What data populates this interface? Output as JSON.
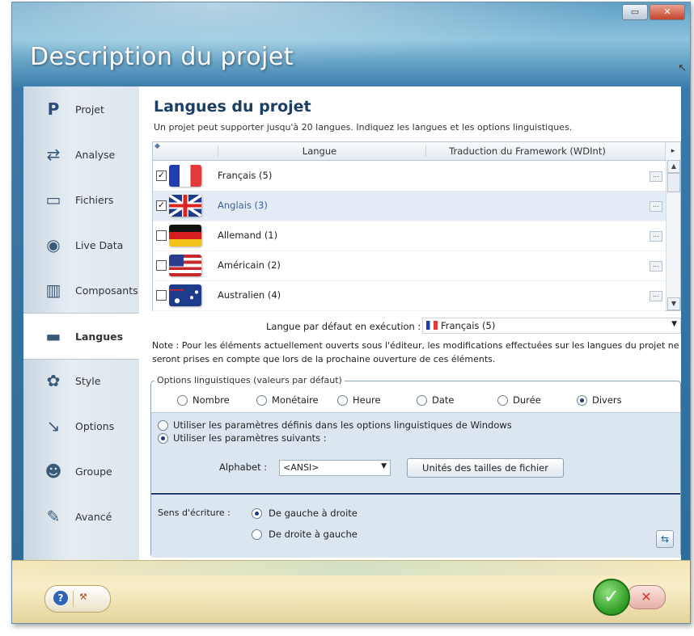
{
  "window": {
    "title": "Description du projet",
    "minimize": "▭",
    "close": "✕"
  },
  "sidebar": {
    "items": [
      {
        "label": "Projet",
        "icon": "P"
      },
      {
        "label": "Analyse",
        "icon": "⇄"
      },
      {
        "label": "Fichiers",
        "icon": "▭"
      },
      {
        "label": "Live Data",
        "icon": "◉"
      },
      {
        "label": "Composants",
        "icon": "▥"
      },
      {
        "label": "Langues",
        "icon": "▬"
      },
      {
        "label": "Style",
        "icon": "✿"
      },
      {
        "label": "Options",
        "icon": "↘"
      },
      {
        "label": "Groupe",
        "icon": "☻"
      },
      {
        "label": "Avancé",
        "icon": "✎"
      }
    ]
  },
  "main": {
    "heading": "Langues du projet",
    "intro": "Un projet peut supporter jusqu'à 20 langues. Indiquez les langues et les options linguistiques.",
    "table": {
      "columns": [
        "Langue",
        "Traduction du Framework (WDInt)"
      ],
      "rows": [
        {
          "checked": true,
          "name": "Français (5)"
        },
        {
          "checked": true,
          "name": "Anglais (3)"
        },
        {
          "checked": false,
          "name": "Allemand (1)"
        },
        {
          "checked": false,
          "name": "Américain (2)"
        },
        {
          "checked": false,
          "name": "Australien (4)"
        }
      ]
    },
    "default_lang_label": "Langue par défaut en exécution :",
    "default_lang_value": "Français (5)",
    "note": "Note : Pour les éléments actuellement ouverts sous l'éditeur, les modifications effectuées sur les langues du projet ne seront prises en compte que lors de la prochaine ouverture de ces éléments.",
    "options": {
      "legend": "Options linguistiques (valeurs par défaut)",
      "tabs": [
        {
          "label": "Nombre",
          "selected": false
        },
        {
          "label": "Monétaire",
          "selected": false
        },
        {
          "label": "Heure",
          "selected": false
        },
        {
          "label": "Date",
          "selected": false
        },
        {
          "label": "Durée",
          "selected": false
        },
        {
          "label": "Divers",
          "selected": true
        }
      ],
      "use_windows": "Utiliser les paramètres définis dans les options linguistiques de Windows",
      "use_following": "Utiliser les paramètres suivants :",
      "alphabet_label": "Alphabet :",
      "alphabet_value": "<ANSI>",
      "units_button": "Unités des tailles de fichier",
      "sens_label": "Sens d'écriture :",
      "sens_ltr": "De gauche à droite",
      "sens_rtl": "De droite à gauche"
    }
  },
  "bottom": {
    "help": "?",
    "ok": "✓",
    "cancel": "✕"
  }
}
